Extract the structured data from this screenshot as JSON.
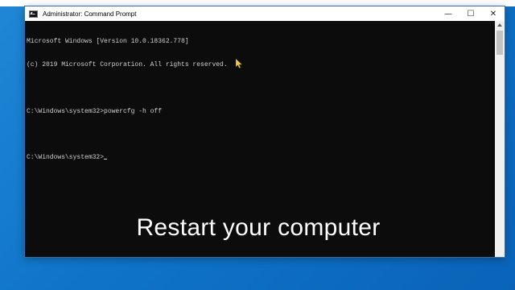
{
  "window": {
    "title": "Administrator: Command Prompt",
    "controls": {
      "minimize": "—",
      "maximize": "☐",
      "close": "✕"
    }
  },
  "console": {
    "lines": [
      "Microsoft Windows [Version 10.0.18362.778]",
      "(c) 2019 Microsoft Corporation. All rights reserved.",
      "",
      "C:\\Windows\\system32>powercfg -h off",
      "",
      "C:\\Windows\\system32>"
    ]
  },
  "overlay": {
    "subtitle": "Restart your computer"
  },
  "icons": {
    "app": "cmd-icon",
    "pointer": "mouse-pointer-icon"
  },
  "colors": {
    "desktop": "#0f74c8",
    "console_bg": "#0c0c0c",
    "console_text": "#cfcfcf",
    "pointer": "#f2c94c"
  }
}
